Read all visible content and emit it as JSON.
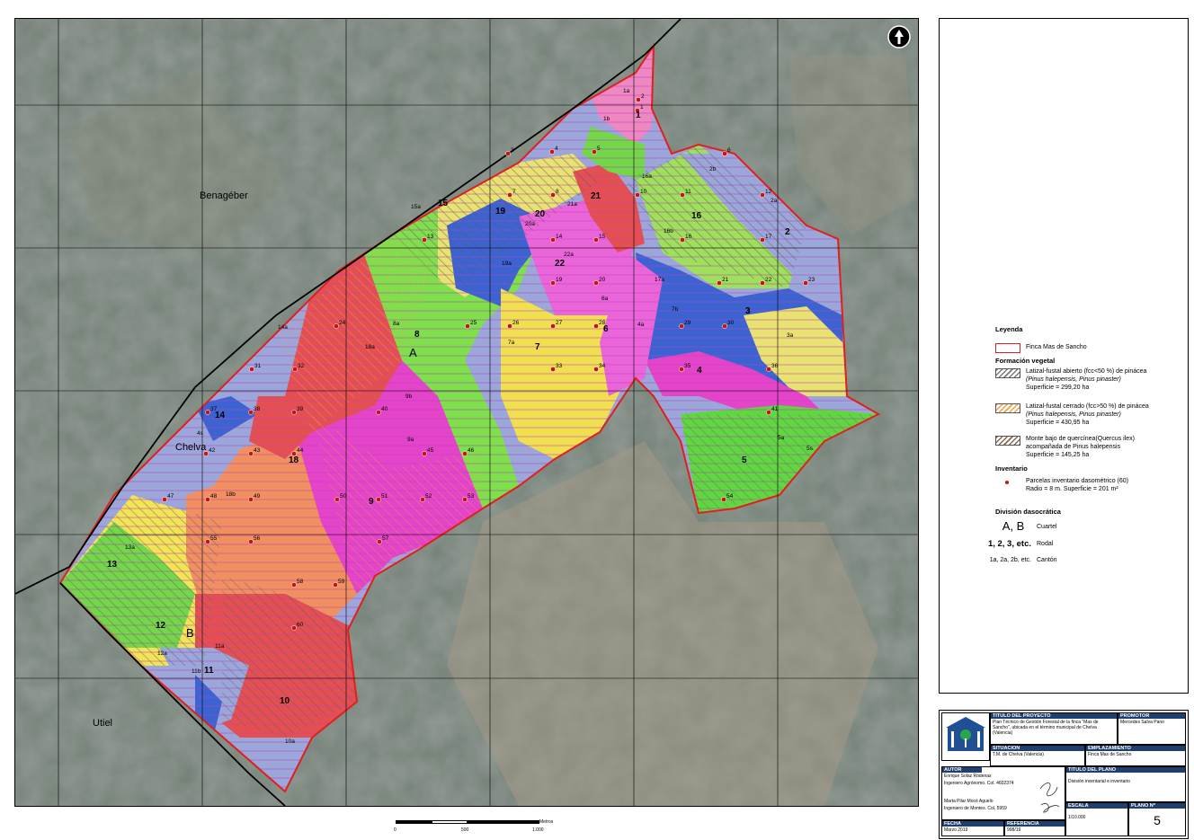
{
  "map": {
    "town_labels": [
      "Benagéber",
      "Chelva",
      "Utiel"
    ],
    "cuarteles": [
      "A",
      "B"
    ],
    "rodales": [
      "1",
      "2",
      "3",
      "4",
      "5",
      "6",
      "7",
      "8",
      "9",
      "10",
      "11",
      "12",
      "13",
      "14",
      "15",
      "16",
      "18",
      "19",
      "20",
      "21",
      "22"
    ],
    "cantones": [
      "1a",
      "1b",
      "2a",
      "2b",
      "3a",
      "4a",
      "4s",
      "5a",
      "5s",
      "6a",
      "7a",
      "7b",
      "8a",
      "9a",
      "9b",
      "10a",
      "11a",
      "11b",
      "12a",
      "13a",
      "14a",
      "15a",
      "16a",
      "16b",
      "17a",
      "18a",
      "18b",
      "19a",
      "20a",
      "21a",
      "22a"
    ],
    "plot_numbers": [
      "1",
      "2",
      "3",
      "4",
      "5",
      "6",
      "7",
      "8",
      "9",
      "10",
      "11",
      "12",
      "13",
      "14",
      "15",
      "16",
      "17",
      "18",
      "19",
      "20",
      "21",
      "22",
      "23",
      "24",
      "25",
      "26",
      "27",
      "28",
      "29",
      "30",
      "31",
      "32",
      "33",
      "34",
      "35",
      "36",
      "37",
      "38",
      "39",
      "40",
      "41",
      "42",
      "43",
      "44",
      "45",
      "46",
      "47",
      "48",
      "49",
      "50",
      "51",
      "52",
      "53",
      "54",
      "55",
      "56",
      "57",
      "58",
      "59",
      "60"
    ],
    "north_arrow": "north-arrow-icon"
  },
  "legend": {
    "title": "Leyenda",
    "finca": "Finca Mas de Sancho",
    "formacion_title": "Formación vegetal",
    "f1_line1": "Latizal-fustal abierto (fcc<50 %) de pinácea",
    "f1_line2": "(Pinus halepensis, Pinus pinaster)",
    "f1_line3": "Superficie = 299,20 ha",
    "f2_line1": "Latizal-fustal cerrado (fcc>50 %) de pinácea",
    "f2_line2": "(Pinus halepensis, Pinus pinaster)",
    "f2_line3": "Superficie = 430,95 ha",
    "f3_line1": "Monte bajo de quercínea(Quercus ilex)",
    "f3_line2": "acompañada de Pinus halepensis",
    "f3_line3": "Superficie = 145,25 ha",
    "inventario_title": "Inventario",
    "inv_line1": "Parcelas inventario dasométrico (60)",
    "inv_line2": "Radio = 8 m. Superficie = 201 m²",
    "division_title": "División dasocrática",
    "div1_key": "A, B",
    "div1_val": "Cuartel",
    "div2_key": "1, 2, 3, etc.",
    "div2_val": "Rodal",
    "div3_key": "1a, 2a, 2b, etc.",
    "div3_val": "Cantón",
    "colors": {
      "finca": "#e0201c",
      "open": "#7a7a7a",
      "closed": "#f0a040",
      "oak": "#8a6a50",
      "plot": "#cc1111"
    }
  },
  "title_block": {
    "proyecto_label": "TÍTULO DEL PROYECTO",
    "proyecto_text": "Plan Técnico de Gestión Forestal de la finca \"Mas de Sancho\", ubicada en el término municipal de Chelva (Valencia)",
    "promotor_label": "PROMOTOR",
    "promotor_text": "Mercedes Salva Pano",
    "situacion_label": "SITUACIÓN",
    "situacion_text": "T.M. de Chelva (Valencia)",
    "emplazamiento_label": "EMPLAZAMIENTO",
    "emplazamiento_text": "Finca Mas de Sancho",
    "autor_label": "AUTOR",
    "autor1_name": "Enrique Solaz Ródenas",
    "autor1_title": "Ingeniero Agrónomo. Col. 4602374",
    "autor2_name": "Marta Pilar Mocé Aguelo",
    "autor2_title": "Ingeniero de Montes. Col. 5959",
    "titulo_plano_label": "TÍTULO DEL PLANO",
    "titulo_plano_text": "División inventarial e inventario",
    "escala_label": "ESCALA",
    "escala_text": "1/10.000",
    "plano_label": "PLANO Nº",
    "plano_text": "5",
    "fecha_label": "FECHA",
    "fecha_text": "Marzo 2019",
    "referencia_label": "REFERENCIA",
    "referencia_text": "998/19"
  },
  "scale_bar": {
    "unit": "Metros",
    "labels": [
      "0",
      "500",
      "1.000"
    ]
  }
}
